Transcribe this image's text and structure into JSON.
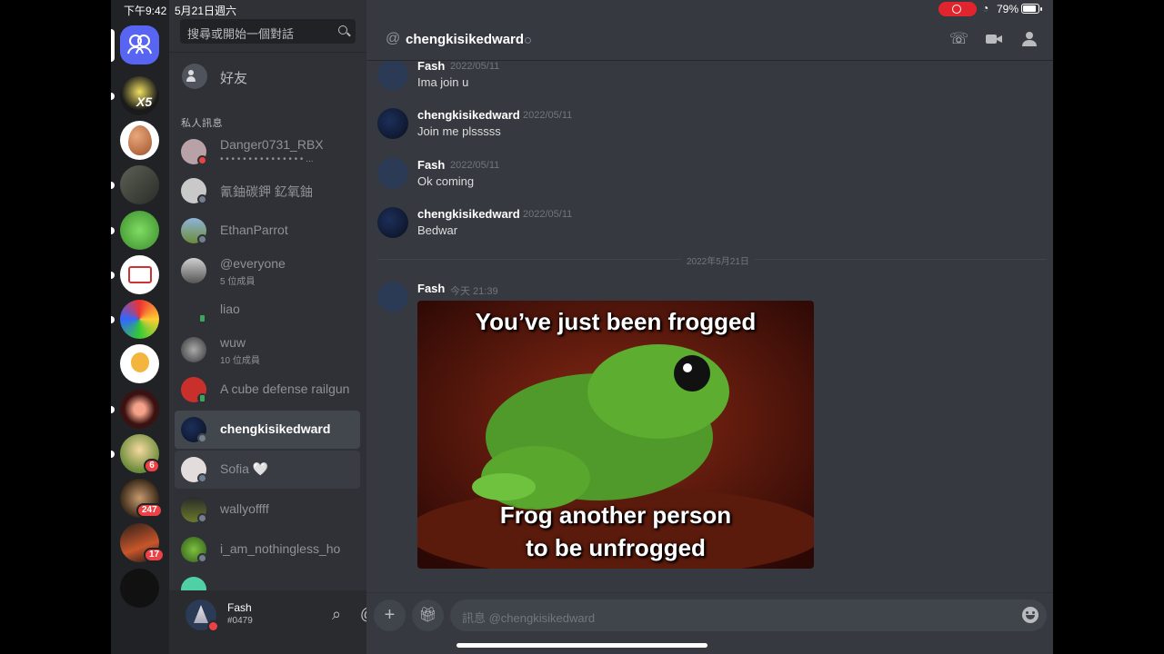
{
  "status_bar": {
    "time": "下午9:42",
    "date": "5月21日週六",
    "battery": "79%"
  },
  "search": {
    "placeholder": "搜尋或開始一個對話"
  },
  "friends_label": "好友",
  "dm_section_header": "私人訊息",
  "dms": [
    {
      "name": "Danger0731_RBX",
      "sub": "• • • • • • • • • • • • • • • ...",
      "status": "dnd"
    },
    {
      "name": "氰鈾碳鉀 釔氧鈾",
      "status": "offline"
    },
    {
      "name": "EthanParrot",
      "status": "offline"
    },
    {
      "name": "@everyone",
      "sub": "5 位成員",
      "status": "none"
    },
    {
      "name": "liao",
      "status": "mobile"
    },
    {
      "name": "wuw",
      "sub": "10 位成員",
      "status": "none"
    },
    {
      "name": "A cube defense railgun",
      "status": "mobile"
    },
    {
      "name": "chengkisikedward",
      "status": "offline",
      "selected": true
    },
    {
      "name": "Sofia 🤍",
      "status": "offline",
      "hovered": true
    },
    {
      "name": "wallyoffff",
      "status": "offline"
    },
    {
      "name": "i_am_nothingless_ho",
      "status": "offline"
    }
  ],
  "rail": {
    "badges": [
      "6",
      "247",
      "17"
    ]
  },
  "user": {
    "name": "Fash",
    "tag": "#0479"
  },
  "chat": {
    "channel_name": "chengkisikedward",
    "messages": [
      {
        "author": "Fash",
        "timestamp": "2022/05/11",
        "text": "Ima join u"
      },
      {
        "author": "chengkisikedward",
        "timestamp": "2022/05/11",
        "text": "Join me plsssss"
      },
      {
        "author": "Fash",
        "timestamp": "2022/05/11",
        "text": "Ok coming"
      },
      {
        "author": "chengkisikedward",
        "timestamp": "2022/05/11",
        "text": "Bedwar"
      }
    ],
    "day_divider": "2022年5月21日",
    "last_message": {
      "author": "Fash",
      "timestamp": "今天 21:39",
      "image_lines": [
        "You’ve just been frogged",
        "Frog another person",
        "to be unfrogged"
      ]
    },
    "input_placeholder": "訊息 @chengkisikedward"
  },
  "colors": {
    "brand": "#5865f2",
    "danger": "#ed4245",
    "background": "#36393f",
    "sidebar": "#2f3136"
  }
}
